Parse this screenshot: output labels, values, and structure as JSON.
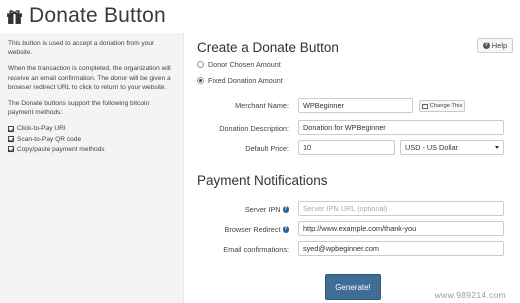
{
  "header": {
    "title": "Donate Button",
    "icon": "gift-icon"
  },
  "sidebar": {
    "paragraphs": [
      "This button is used to accept a donation from your website.",
      "When the transaction is completed, the organization will receive an email confirmation. The donor will be given a browser redirect URL to click to return to your website.",
      "The Donate buttons support the following bitcoin payment methods:"
    ],
    "features": [
      "Click-to-Pay URI",
      "Scan-to-Pay QR code",
      "Copy/paste payment methods"
    ]
  },
  "main": {
    "help_label": "Help",
    "create_title": "Create a Donate Button",
    "radios": [
      {
        "label": "Donor Chosen Amount",
        "checked": false
      },
      {
        "label": "Fixed Donation Amount",
        "checked": true
      }
    ],
    "merchant": {
      "label": "Merchant Name:",
      "value": "WPBeginner",
      "change_label": "Change This"
    },
    "description": {
      "label": "Donation Description:",
      "value": "Donation for WPBeginner"
    },
    "price": {
      "label": "Default Price:",
      "value": "10",
      "currency": "USD - US Dollar"
    },
    "notify_title": "Payment Notifications",
    "server_ipn": {
      "label": "Server IPN",
      "placeholder": "Server IPN URL (optional)"
    },
    "browser_redirect": {
      "label": "Browser Redirect",
      "value": "http://www.example.com/thank-you"
    },
    "email": {
      "label": "Email confirmations:",
      "value": "syed@wpbeginner.com"
    },
    "generate_label": "Generate!"
  },
  "watermark": "www.989214.com",
  "colors": {
    "primary_button": "#3f6d96",
    "info_icon": "#2a6496",
    "sidebar_bg": "#f4f4f4"
  }
}
